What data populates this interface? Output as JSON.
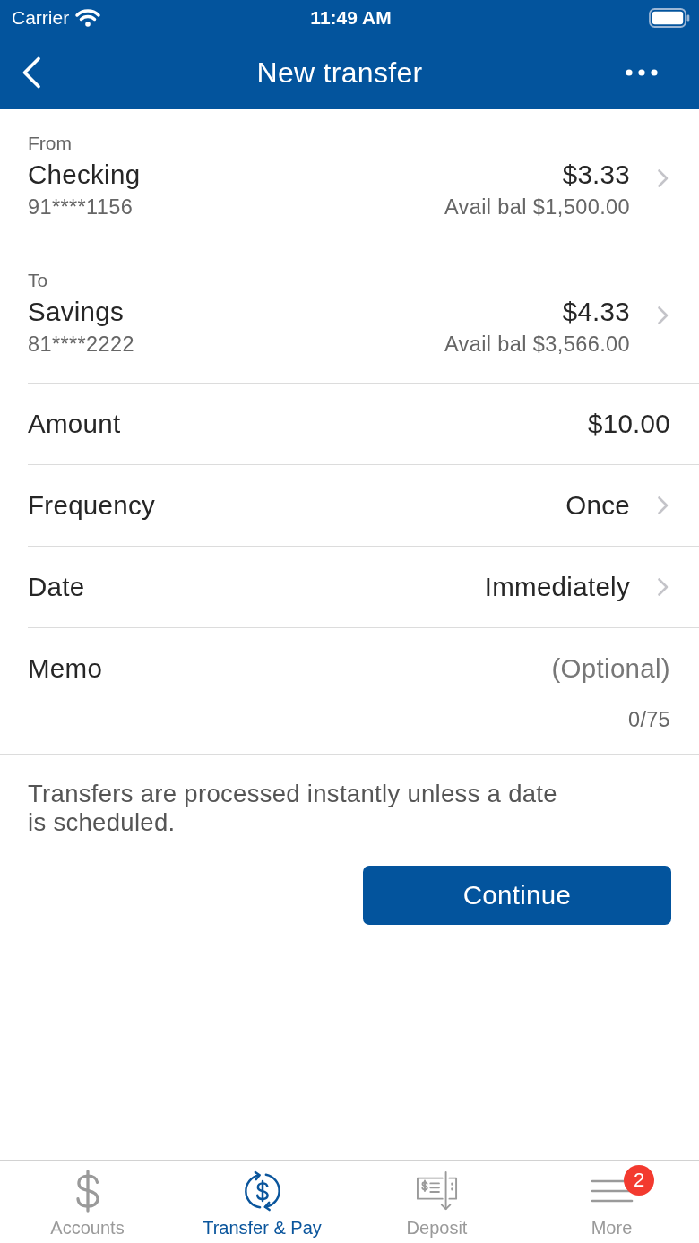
{
  "status_bar": {
    "carrier": "Carrier",
    "time": "11:49 AM"
  },
  "nav": {
    "title": "New transfer"
  },
  "accounts": [
    {
      "label": "From",
      "name": "Checking",
      "number": "91****1156",
      "balance": "$3.33",
      "available": "Avail bal $1,500.00"
    },
    {
      "label": "To",
      "name": "Savings",
      "number": "81****2222",
      "balance": "$4.33",
      "available": "Avail bal $3,566.00"
    }
  ],
  "fields": [
    {
      "kind": "static",
      "label": "Amount",
      "value": "$10.00"
    },
    {
      "kind": "picker",
      "label": "Frequency",
      "value": "Once"
    },
    {
      "kind": "picker",
      "label": "Date",
      "value": "Immediately"
    },
    {
      "kind": "memo",
      "label": "Memo",
      "placeholder": "(Optional)",
      "counter": "0/75"
    }
  ],
  "note": "Transfers are processed instantly unless a date is scheduled.",
  "continue_button": "Continue",
  "tabs": [
    {
      "kind": "accounts",
      "label": "Accounts",
      "selected": false
    },
    {
      "kind": "transfer",
      "label": "Transfer & Pay",
      "selected": true
    },
    {
      "kind": "deposit",
      "label": "Deposit",
      "selected": false
    },
    {
      "kind": "more",
      "label": "More",
      "selected": false,
      "badge": "2"
    }
  ]
}
